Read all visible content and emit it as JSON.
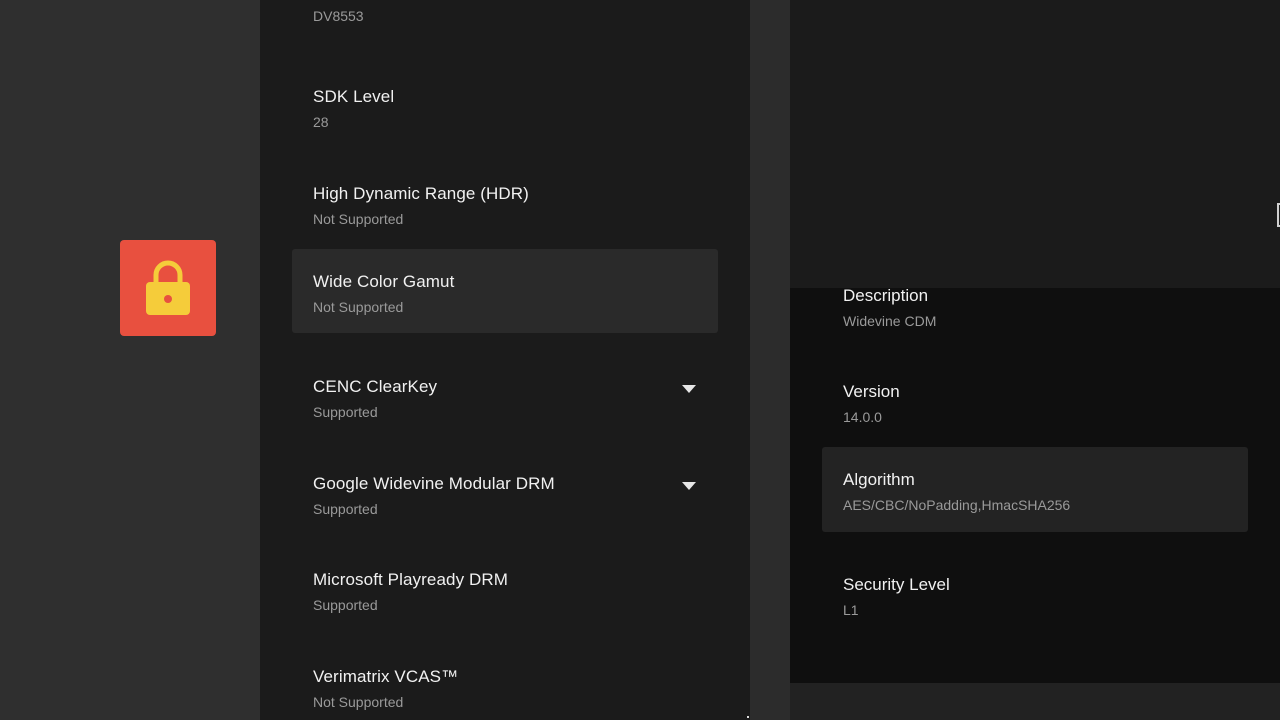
{
  "app": {
    "icon": "lock-icon",
    "icon_bg_color": "#e8503f",
    "icon_fg_color": "#f5cc3a"
  },
  "main": {
    "top_partial_value": "DV8553",
    "items": [
      {
        "title": "SDK Level",
        "value": "28"
      },
      {
        "title": "High Dynamic Range (HDR)",
        "value": "Not Supported"
      },
      {
        "title": "Wide Color Gamut",
        "value": "Not Supported"
      },
      {
        "title": "CENC ClearKey",
        "value": "Supported",
        "expand_icon": "chevron-down-icon"
      },
      {
        "title": "Google Widevine Modular DRM",
        "value": "Supported",
        "expand_icon": "chevron-down-icon"
      },
      {
        "title": "Microsoft Playready DRM",
        "value": "Supported"
      },
      {
        "title": "Verimatrix VCAS™",
        "value": "Not Supported"
      }
    ]
  },
  "detail": {
    "items": [
      {
        "title": "Description",
        "value": "Widevine CDM"
      },
      {
        "title": "Version",
        "value": "14.0.0"
      },
      {
        "title": "Algorithm",
        "value": "AES/CBC/NoPadding,HmacSHA256"
      },
      {
        "title": "Security Level",
        "value": "L1"
      }
    ]
  }
}
